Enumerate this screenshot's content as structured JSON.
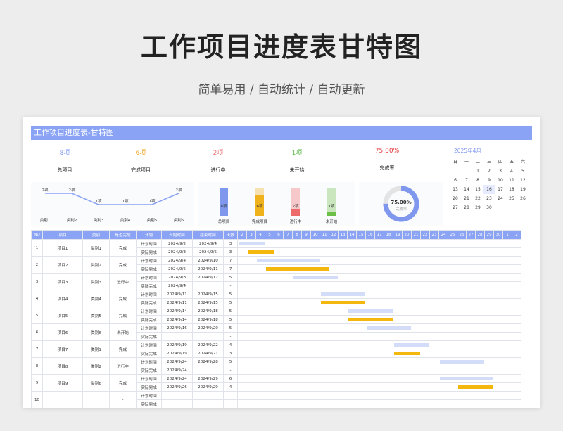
{
  "hero": {
    "title": "工作项目进度表甘特图",
    "subtitle": "简单易用  /  自动统计  /  自动更新"
  },
  "sheet_title": "工作项目进度表-甘特图",
  "stats": [
    {
      "value": "8项",
      "label": "总项目",
      "color": "#7f98ee"
    },
    {
      "value": "6项",
      "label": "完成项目",
      "color": "#f0a21c"
    },
    {
      "value": "2项",
      "label": "进行中",
      "color": "#ee7b7b"
    },
    {
      "value": "1项",
      "label": "未开始",
      "color": "#5cba47"
    },
    {
      "value": "75.00%",
      "label": "完成率",
      "color": "#e03a3a"
    }
  ],
  "line_chart": {
    "categories": [
      "类别1",
      "类别2",
      "类别3",
      "类别4",
      "类别5",
      "类别6"
    ],
    "values": [
      2,
      2,
      1,
      1,
      1,
      2
    ],
    "labels": [
      "2项",
      "2项",
      "1项",
      "1项",
      "1项",
      "2项"
    ]
  },
  "bar_chart": {
    "categories": [
      "总项目",
      "完成项目",
      "进行中",
      "未开始"
    ],
    "values": [
      8,
      6,
      2,
      1
    ],
    "labels": [
      "8项",
      "6项",
      "2项",
      "1项"
    ],
    "colors": [
      "#7f98ee",
      "#f0b21c",
      "#ee6b6b",
      "#6cc047"
    ]
  },
  "donut": {
    "percent": 0.75,
    "value_text": "75.00%",
    "label": "完成率",
    "color": "#7f98ee"
  },
  "calendar": {
    "title": "2025年4月",
    "weekdays": [
      "日",
      "一",
      "二",
      "三",
      "四",
      "五",
      "六"
    ],
    "cells": [
      "",
      "",
      "1",
      "2",
      "3",
      "4",
      "5",
      "6",
      "7",
      "8",
      "9",
      "10",
      "11",
      "12",
      "13",
      "14",
      "15",
      "16",
      "17",
      "18",
      "19",
      "20",
      "21",
      "22",
      "23",
      "24",
      "25",
      "26",
      "27",
      "28",
      "29",
      "30",
      "",
      "",
      ""
    ],
    "highlight": "16"
  },
  "table": {
    "headers": [
      "NO",
      "项目",
      "类别",
      "是否完成",
      "计划",
      "开始时间",
      "结束时间",
      "天数"
    ],
    "days": [
      "2",
      "3",
      "4",
      "5",
      "6",
      "7",
      "8",
      "9",
      "10",
      "11",
      "12",
      "13",
      "14",
      "15",
      "16",
      "17",
      "18",
      "19",
      "20",
      "21",
      "22",
      "23",
      "24",
      "25",
      "26",
      "27",
      "28",
      "29",
      "30",
      "1",
      "2"
    ],
    "projects": [
      {
        "no": "1",
        "name": "项目1",
        "cat": "类别1",
        "status": "完成",
        "plan": {
          "label": "计划时间",
          "start": "2024/9/2",
          "end": "2024/9/4",
          "days": "3",
          "s": 0,
          "n": 3
        },
        "actual": {
          "label": "实际完成",
          "start": "2024/9/3",
          "end": "2024/9/5",
          "days": "3",
          "s": 1,
          "n": 3
        }
      },
      {
        "no": "2",
        "name": "项目2",
        "cat": "类别2",
        "status": "完成",
        "plan": {
          "label": "计划时间",
          "start": "2024/9/4",
          "end": "2024/9/10",
          "days": "7",
          "s": 2,
          "n": 7
        },
        "actual": {
          "label": "实际完成",
          "start": "2024/9/5",
          "end": "2024/9/11",
          "days": "7",
          "s": 3,
          "n": 7
        }
      },
      {
        "no": "3",
        "name": "项目3",
        "cat": "类别3",
        "status": "进行中",
        "plan": {
          "label": "计划时间",
          "start": "2024/9/8",
          "end": "2024/9/12",
          "days": "5",
          "s": 6,
          "n": 5
        },
        "actual": {
          "label": "实际完成",
          "start": "2024/9/4",
          "end": "",
          "days": "-",
          "s": 0,
          "n": 0
        }
      },
      {
        "no": "4",
        "name": "项目4",
        "cat": "类别4",
        "status": "完成",
        "plan": {
          "label": "计划时间",
          "start": "2024/9/11",
          "end": "2024/9/15",
          "days": "5",
          "s": 9,
          "n": 5
        },
        "actual": {
          "label": "实际完成",
          "start": "2024/9/11",
          "end": "2024/9/15",
          "days": "5",
          "s": 9,
          "n": 5
        }
      },
      {
        "no": "5",
        "name": "项目5",
        "cat": "类别5",
        "status": "完成",
        "plan": {
          "label": "计划时间",
          "start": "2024/9/14",
          "end": "2024/9/18",
          "days": "5",
          "s": 12,
          "n": 5
        },
        "actual": {
          "label": "实际完成",
          "start": "2024/9/14",
          "end": "2024/9/18",
          "days": "5",
          "s": 12,
          "n": 5
        }
      },
      {
        "no": "6",
        "name": "项目6",
        "cat": "类别6",
        "status": "未开始",
        "plan": {
          "label": "计划时间",
          "start": "2024/9/16",
          "end": "2024/9/20",
          "days": "5",
          "s": 14,
          "n": 5
        },
        "actual": {
          "label": "实际完成",
          "start": "",
          "end": "",
          "days": "-",
          "s": 0,
          "n": 0
        }
      },
      {
        "no": "7",
        "name": "项目7",
        "cat": "类别1",
        "status": "完成",
        "plan": {
          "label": "计划时间",
          "start": "2024/9/19",
          "end": "2024/9/22",
          "days": "4",
          "s": 17,
          "n": 4
        },
        "actual": {
          "label": "实际完成",
          "start": "2024/9/19",
          "end": "2024/9/21",
          "days": "3",
          "s": 17,
          "n": 3
        }
      },
      {
        "no": "8",
        "name": "项目8",
        "cat": "类别2",
        "status": "进行中",
        "plan": {
          "label": "计划时间",
          "start": "2024/9/24",
          "end": "2024/9/28",
          "days": "5",
          "s": 22,
          "n": 5
        },
        "actual": {
          "label": "实际完成",
          "start": "2024/9/24",
          "end": "",
          "days": "-",
          "s": 0,
          "n": 0
        }
      },
      {
        "no": "9",
        "name": "项目9",
        "cat": "类别6",
        "status": "完成",
        "plan": {
          "label": "计划时间",
          "start": "2024/9/24",
          "end": "2024/9/29",
          "days": "6",
          "s": 22,
          "n": 6
        },
        "actual": {
          "label": "实际完成",
          "start": "2024/9/26",
          "end": "2024/9/29",
          "days": "4",
          "s": 24,
          "n": 4
        }
      },
      {
        "no": "10",
        "name": "",
        "cat": "",
        "status": "-",
        "plan": {
          "label": "计划时间",
          "start": "",
          "end": "",
          "days": "",
          "s": 0,
          "n": 0
        },
        "actual": {
          "label": "实际完成",
          "start": "",
          "end": "",
          "days": "",
          "s": 0,
          "n": 0
        }
      }
    ]
  }
}
